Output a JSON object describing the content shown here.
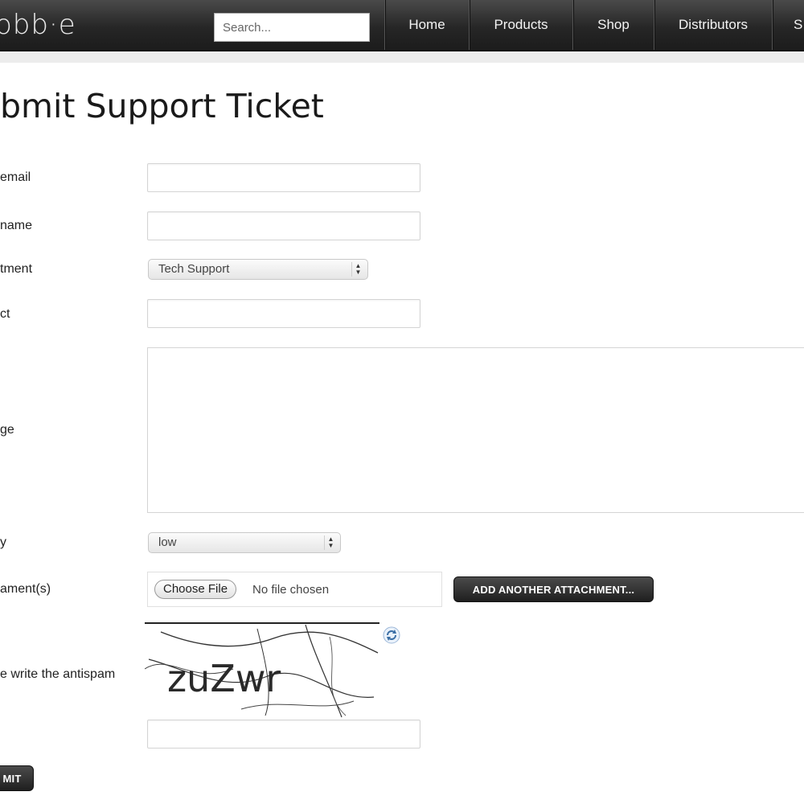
{
  "header": {
    "logo_text": "obb·e",
    "search_placeholder": "Search...",
    "nav": [
      "Home",
      "Products",
      "Shop",
      "Distributors",
      "S"
    ]
  },
  "page": {
    "title": "bmit Support Ticket"
  },
  "form": {
    "email_label": "email",
    "name_label": "name",
    "department_label": "tment",
    "department_value": "Tech Support",
    "subject_label": "ct",
    "message_label": "ge",
    "priority_label": "y",
    "priority_value": "low",
    "attachments_label": "ament(s)",
    "choose_file_label": "Choose File",
    "no_file_text": "No file chosen",
    "add_attachment_label": "ADD ANOTHER ATTACHMENT...",
    "antispam_label": "e write the antispam",
    "captcha_text": "zuZwr",
    "submit_label": "MIT"
  }
}
